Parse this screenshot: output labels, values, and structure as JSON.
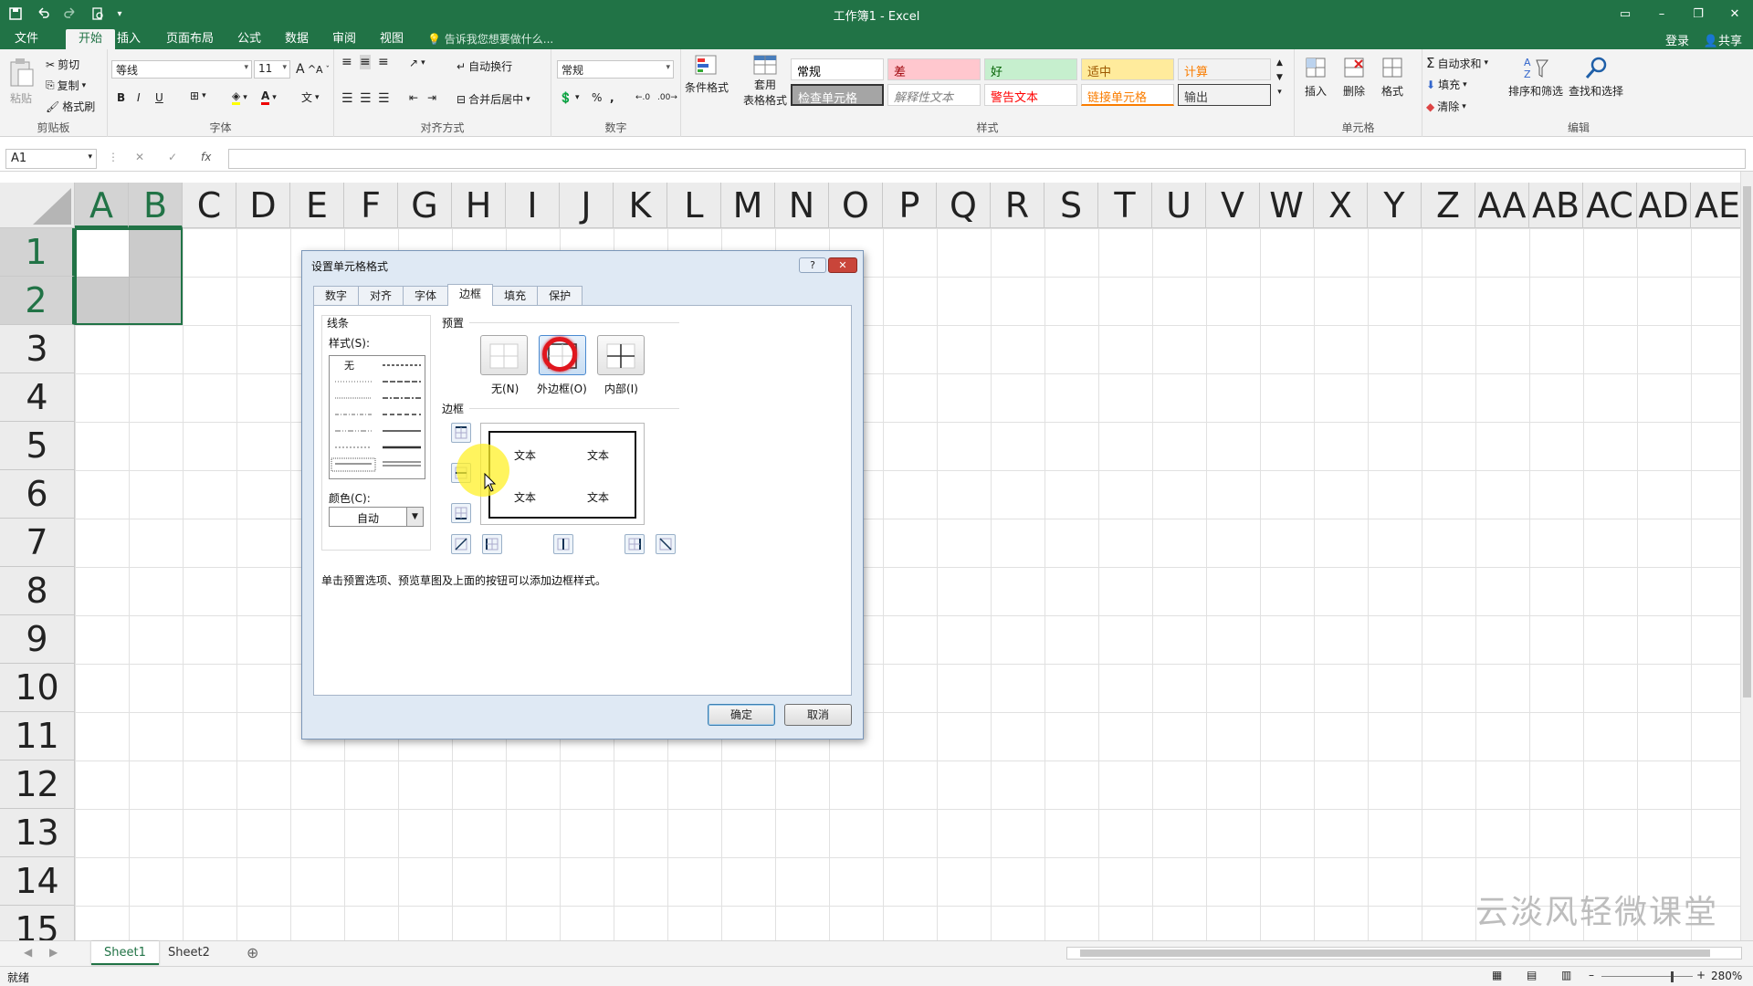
{
  "window": {
    "title": "工作簿1 - Excel"
  },
  "tabs": [
    {
      "label": "文件"
    },
    {
      "label": "开始"
    },
    {
      "label": "插入"
    },
    {
      "label": "页面布局"
    },
    {
      "label": "公式"
    },
    {
      "label": "数据"
    },
    {
      "label": "审阅"
    },
    {
      "label": "视图"
    }
  ],
  "tell_me": "告诉我您想要做什么...",
  "account": {
    "login": "登录",
    "share": "共享"
  },
  "ribbon": {
    "clipboard": {
      "label": "剪贴板",
      "paste": "粘贴",
      "cut": "剪切",
      "copy": "复制",
      "format_painter": "格式刷"
    },
    "font": {
      "label": "字体",
      "name": "等线",
      "size": "11",
      "bold": "B",
      "italic": "I",
      "underline": "U",
      "grow": "A",
      "shrink": "A"
    },
    "alignment": {
      "label": "对齐方式",
      "wrap": "自动换行",
      "merge": "合并后居中"
    },
    "number": {
      "label": "数字",
      "format": "常规",
      "percent": "%",
      "comma": ","
    },
    "styles": {
      "label": "样式",
      "conditional": "条件格式",
      "table1": "套用",
      "table2": "表格格式",
      "cells": [
        {
          "text": "常规",
          "bg": "#ffffff",
          "fg": "#000000"
        },
        {
          "text": "差",
          "bg": "#ffc7ce",
          "fg": "#9c0006"
        },
        {
          "text": "好",
          "bg": "#c6efce",
          "fg": "#006100"
        },
        {
          "text": "适中",
          "bg": "#ffeb9c",
          "fg": "#9c5700"
        },
        {
          "text": "计算",
          "bg": "#f2f2f2",
          "fg": "#fa7d00"
        },
        {
          "text": "检查单元格",
          "bg": "#a5a5a5",
          "fg": "#ffffff"
        },
        {
          "text": "解释性文本",
          "bg": "#ffffff",
          "fg": "#7f7f7f"
        },
        {
          "text": "警告文本",
          "bg": "#ffffff",
          "fg": "#ff0000"
        },
        {
          "text": "链接单元格",
          "bg": "#ffffff",
          "fg": "#fa7d00"
        },
        {
          "text": "输出",
          "bg": "#f2f2f2",
          "fg": "#3f3f3f"
        }
      ]
    },
    "cells": {
      "label": "单元格",
      "insert": "插入",
      "delete": "删除",
      "format": "格式"
    },
    "editing": {
      "label": "编辑",
      "autosum": "自动求和",
      "fill": "填充",
      "clear": "清除",
      "sort": "排序和筛选",
      "find": "查找和选择"
    }
  },
  "formula_bar": {
    "name_box": "A1",
    "fx": "fx",
    "cancel": "✕",
    "enter": "✓"
  },
  "grid": {
    "columns": [
      "A",
      "B",
      "C",
      "D",
      "E",
      "F",
      "G",
      "H",
      "I",
      "J",
      "K",
      "L",
      "M",
      "N",
      "O",
      "P",
      "Q",
      "R",
      "S",
      "T",
      "U",
      "V",
      "W",
      "X",
      "Y",
      "Z",
      "AA",
      "AB",
      "AC",
      "AD",
      "AE"
    ],
    "rows": [
      "1",
      "2",
      "3",
      "4",
      "5",
      "6",
      "7",
      "8",
      "9",
      "10",
      "11",
      "12",
      "13",
      "14",
      "15"
    ]
  },
  "dialog": {
    "title": "设置单元格格式",
    "help": "?",
    "close": "✕",
    "tabs": [
      "数字",
      "对齐",
      "字体",
      "边框",
      "填充",
      "保护"
    ],
    "line_group": "线条",
    "style_label": "样式(S):",
    "style_none": "无",
    "color_label": "颜色(C):",
    "color_value": "自动",
    "presets_label": "预置",
    "presets": [
      "无(N)",
      "外边框(O)",
      "内部(I)"
    ],
    "border_label": "边框",
    "preview_text": [
      "文本",
      "文本",
      "文本",
      "文本"
    ],
    "hint": "单击预置选项、预览草图及上面的按钮可以添加边框样式。",
    "ok": "确定",
    "cancel": "取消"
  },
  "sheets": [
    "Sheet1",
    "Sheet2"
  ],
  "status": {
    "ready": "就绪",
    "zoom": "280%"
  },
  "watermark": "云淡风轻微课堂",
  "colors": {
    "accent": "#217346",
    "ring": "#e0161e",
    "cursor_highlight": "#fff028"
  }
}
